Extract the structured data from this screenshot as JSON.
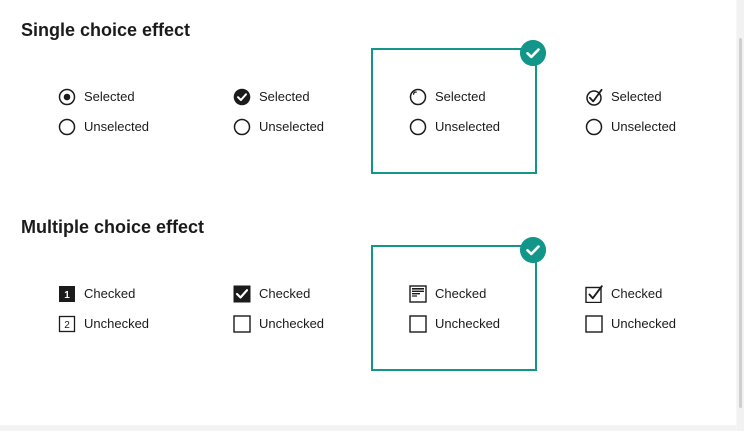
{
  "single": {
    "title": "Single choice effect",
    "selected_label": "Selected",
    "unselected_label": "Unselected",
    "styles": [
      {
        "name": "radio-dot",
        "selected_icon": "radio-dot-icon",
        "unselected_icon": "radio-empty-icon",
        "active": false
      },
      {
        "name": "filled-check",
        "selected_icon": "check-circle-filled-icon",
        "unselected_icon": "radio-empty-icon",
        "active": false
      },
      {
        "name": "notch-circle",
        "selected_icon": "radio-notch-icon",
        "unselected_icon": "radio-empty-icon",
        "active": true
      },
      {
        "name": "outline-check",
        "selected_icon": "check-circle-outline-icon",
        "unselected_icon": "radio-empty-icon",
        "active": false
      }
    ]
  },
  "multiple": {
    "title": "Multiple choice effect",
    "checked_label": "Checked",
    "unchecked_label": "Unchecked",
    "checked_number": "1",
    "unchecked_number": "2",
    "styles": [
      {
        "name": "numbered",
        "checked_icon": "numbered-box-filled-icon",
        "unchecked_icon": "numbered-box-outline-icon",
        "active": false
      },
      {
        "name": "filled-check",
        "checked_icon": "checkbox-filled-check-icon",
        "unchecked_icon": "checkbox-empty-icon",
        "active": false
      },
      {
        "name": "lines",
        "checked_icon": "checkbox-lines-icon",
        "unchecked_icon": "checkbox-empty-icon",
        "active": true
      },
      {
        "name": "outline-check",
        "checked_icon": "checkbox-outline-check-icon",
        "unchecked_icon": "checkbox-empty-icon",
        "active": false
      }
    ]
  },
  "colors": {
    "accent": "#12968a",
    "text": "#1b1b1b",
    "background": "#ffffff"
  }
}
